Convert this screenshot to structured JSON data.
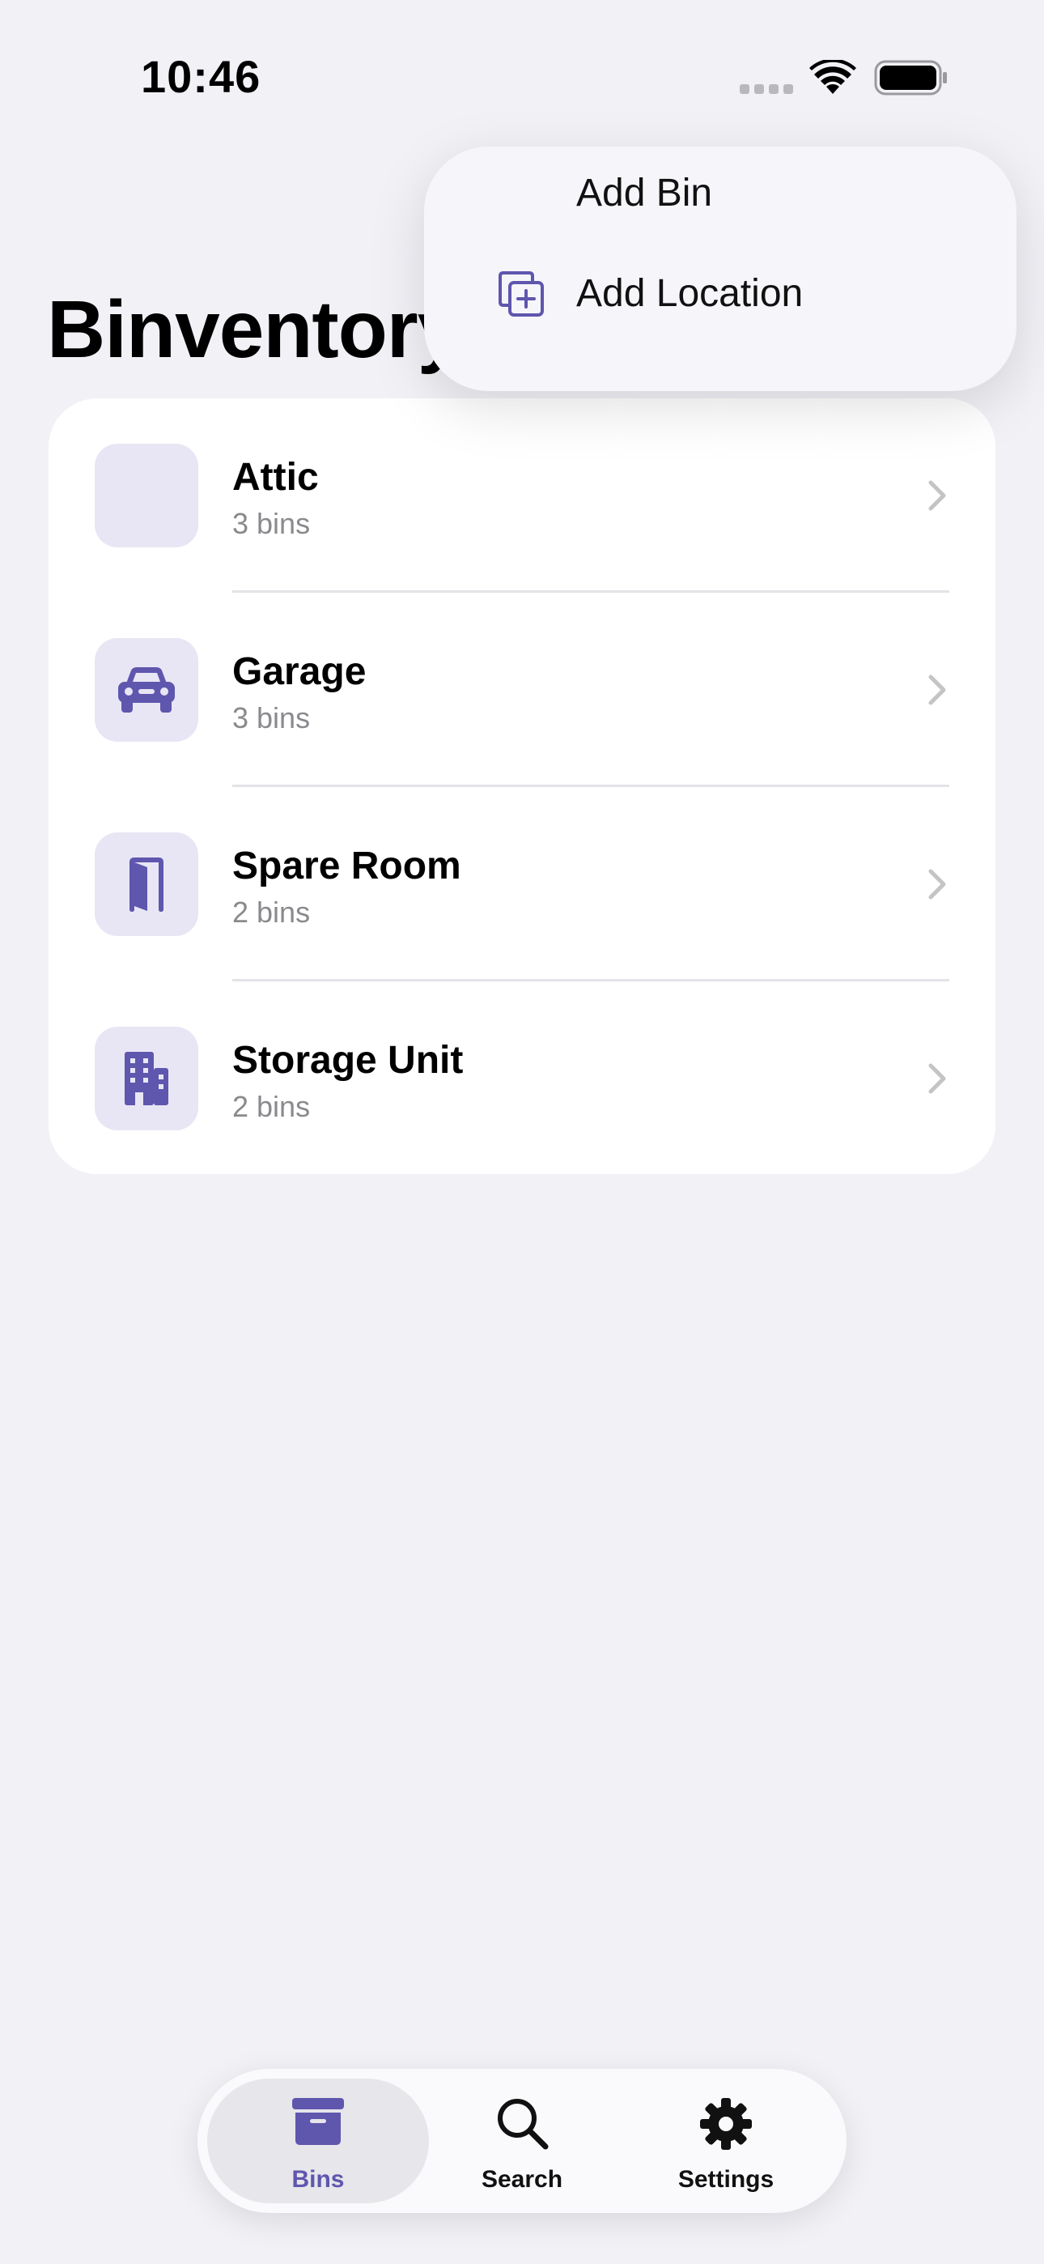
{
  "status_bar": {
    "time": "10:46"
  },
  "page": {
    "title": "Binventory"
  },
  "menu": {
    "items": [
      {
        "label": "Add Bin",
        "icon": "none"
      },
      {
        "label": "Add Location",
        "icon": "add-square-stack-icon"
      }
    ]
  },
  "locations": [
    {
      "name": "Attic",
      "count": "3 bins",
      "icon": "none"
    },
    {
      "name": "Garage",
      "count": "3 bins",
      "icon": "car-icon"
    },
    {
      "name": "Spare Room",
      "count": "2 bins",
      "icon": "door-icon"
    },
    {
      "name": "Storage Unit",
      "count": "2 bins",
      "icon": "building-icon"
    }
  ],
  "tabbar": {
    "tabs": [
      {
        "label": "Bins",
        "icon": "archive-box-icon",
        "active": true
      },
      {
        "label": "Search",
        "icon": "magnifier-icon",
        "active": false
      },
      {
        "label": "Settings",
        "icon": "gear-icon",
        "active": false
      }
    ]
  },
  "colors": {
    "accent": "#5F56AE",
    "background": "#F2F1F6",
    "tile": "#E8E6F4",
    "secondary_text": "#8A8A8E"
  }
}
